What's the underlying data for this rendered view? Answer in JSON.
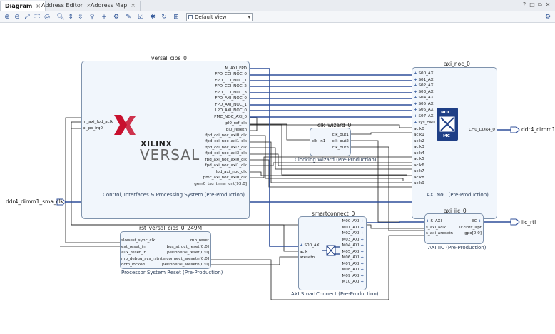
{
  "tabs": [
    {
      "label": "Diagram",
      "active": true
    },
    {
      "label": "Address Editor",
      "active": false
    },
    {
      "label": "Address Map",
      "active": false
    }
  ],
  "window_controls": [
    "?",
    "□",
    "⧉",
    "✕"
  ],
  "toolbar": {
    "view_select": "Default View"
  },
  "blocks": {
    "cips": {
      "title": "versal_cips_0",
      "caption": "Control, Interfaces & Processing System (Pre-Production)",
      "left_pins": [
        "m_axi_fpd_aclk",
        "pl_ps_irq0"
      ],
      "right_pins": [
        "M_AXI_FPD",
        "FPD_CCI_NOC_0",
        "FPD_CCI_NOC_1",
        "FPD_CCI_NOC_2",
        "FPD_CCI_NOC_3",
        "FPD_AXI_NOC_0",
        "FPD_AXI_NOC_1",
        "LPD_AXI_NOC_0",
        "PMC_NOC_AXI_0",
        "pl0_ref_clk",
        "pl0_resetn",
        "fpd_cci_noc_axi0_clk",
        "fpd_cci_noc_axi1_clk",
        "fpd_cci_noc_axi2_clk",
        "fpd_cci_noc_axi3_clk",
        "fpd_axi_noc_axi0_clk",
        "fpd_axi_noc_axi1_clk",
        "lpd_axi_noc_clk",
        "pmc_axi_noc_axi0_clk",
        "gem0_tsu_timer_cnt[93:0]"
      ],
      "logo_top": "XILINX",
      "logo_bottom": "VERSAL"
    },
    "noc": {
      "title": "axi_noc_0",
      "caption": "AXI NoC (Pre-Production)",
      "left_pins": [
        "S00_AXI",
        "S01_AXI",
        "S02_AXI",
        "S03_AXI",
        "S04_AXI",
        "S05_AXI",
        "S06_AXI",
        "S07_AXI",
        "sys_clk0",
        "aclk0",
        "aclk1",
        "aclk2",
        "aclk3",
        "aclk4",
        "aclk5",
        "aclk6",
        "aclk7",
        "aclk8",
        "aclk9"
      ],
      "right_pins": [
        "CH0_DDR4_0"
      ],
      "icon_top": "NOC",
      "icon_bottom": "MC"
    },
    "clk": {
      "title": "clk_wizard_0",
      "caption": "Clocking Wizard (Pre-Production)",
      "left_pins": [
        "clk_in1"
      ],
      "right_pins": [
        "clk_out1",
        "clk_out2",
        "clk_out3"
      ]
    },
    "rst": {
      "title": "rst_versal_cips_0_249M",
      "caption": "Processor System Reset (Pre-Production)",
      "left_pins": [
        "slowest_sync_clk",
        "ext_reset_in",
        "aux_reset_in",
        "mb_debug_sys_rst",
        "dcm_locked"
      ],
      "right_pins": [
        "mb_reset",
        "bus_struct_reset[0:0]",
        "peripheral_reset[0:0]",
        "interconnect_aresetn[0:0]",
        "peripheral_aresetn[0:0]"
      ]
    },
    "sc": {
      "title": "smartconnect_0",
      "caption": "AXI SmartConnect (Pre-Production)",
      "left_pins": [
        "S00_AXI",
        "aclk",
        "aresetn"
      ],
      "right_pins": [
        "M00_AXI",
        "M01_AXI",
        "M02_AXI",
        "M03_AXI",
        "M04_AXI",
        "M05_AXI",
        "M06_AXI",
        "M07_AXI",
        "M08_AXI",
        "M09_AXI",
        "M10_AXI"
      ]
    },
    "iic": {
      "title": "axi_iic_0",
      "caption": "AXI IIC (Pre-Production)",
      "left_pins": [
        "S_AXI",
        "s_axi_aclk",
        "s_axi_aresetn"
      ],
      "right_pins": [
        "IIC",
        "iic2intc_irpt",
        "gpo[0:0]"
      ]
    }
  },
  "ports": {
    "ddr4_out": "ddr4_dimm1",
    "sma_clk_in": "ddr4_dimm1_sma_clk",
    "iic_out": "iic_rtl"
  },
  "colors": {
    "bus": "#2f4f9a",
    "block_fill": "#f1f6fc",
    "block_border": "#7f93ad",
    "xilinx_red": "#c8102e",
    "noc_icon": "#1f3f86"
  }
}
